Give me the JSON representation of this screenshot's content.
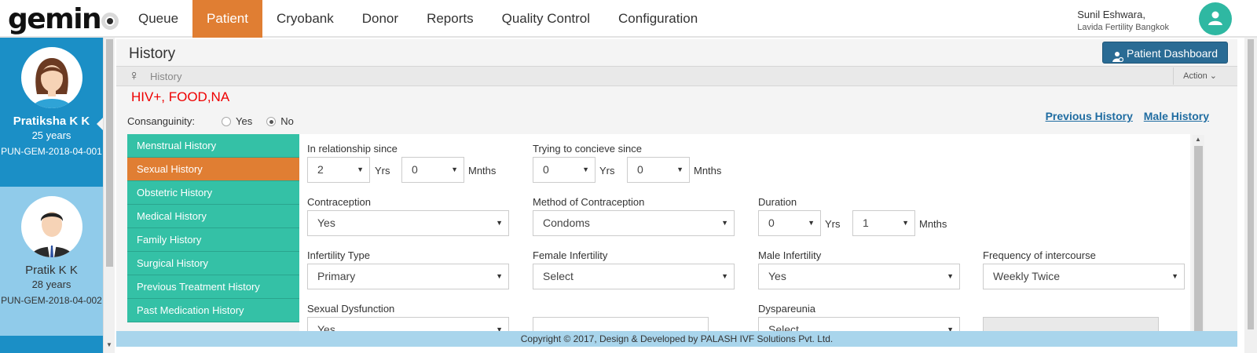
{
  "app": {
    "logo": "gemin"
  },
  "nav": {
    "items": [
      "Queue",
      "Patient",
      "Cryobank",
      "Donor",
      "Reports",
      "Quality Control",
      "Configuration"
    ],
    "active": "Patient"
  },
  "user": {
    "name": "Sunil Eshwara,",
    "org": "Lavida Fertility Bangkok"
  },
  "patients": [
    {
      "name": "Pratiksha K K",
      "age": "25 years",
      "id": "PUN-GEM-2018-04-001"
    },
    {
      "name": "Pratik K K",
      "age": "28 years",
      "id": "PUN-GEM-2018-04-002"
    }
  ],
  "page": {
    "title": "History",
    "dashboard_button": "Patient Dashboard",
    "breadcrumb": "History",
    "action": "Action",
    "alerts": "HIV+, FOOD,NA",
    "consanguinity": {
      "label": "Consanguinity:",
      "options": [
        "Yes",
        "No"
      ],
      "selected": "No"
    },
    "links": {
      "previous": "Previous History",
      "male": "Male History"
    }
  },
  "menu": {
    "items": [
      "Menstrual History",
      "Sexual History",
      "Obstetric History",
      "Medical History",
      "Family History",
      "Surgical History",
      "Previous Treatment History",
      "Past Medication History"
    ],
    "active": "Sexual History"
  },
  "form": {
    "relationship": {
      "label": "In relationship since",
      "years": "2",
      "months": "0",
      "yrs_unit": "Yrs",
      "mnths_unit": "Mnths"
    },
    "conceive": {
      "label": "Trying to concieve since",
      "years": "0",
      "months": "0",
      "yrs_unit": "Yrs",
      "mnths_unit": "Mnths"
    },
    "contraception": {
      "label": "Contraception",
      "value": "Yes"
    },
    "method": {
      "label": "Method of Contraception",
      "value": "Condoms"
    },
    "duration": {
      "label": "Duration",
      "years": "0",
      "months": "1",
      "yrs_unit": "Yrs",
      "mnths_unit": "Mnths"
    },
    "infertility_type": {
      "label": "Infertility Type",
      "value": "Primary"
    },
    "female_infertility": {
      "label": "Female Infertility",
      "value": "Select"
    },
    "male_infertility": {
      "label": "Male Infertility",
      "value": "Yes"
    },
    "frequency": {
      "label": "Frequency of intercourse",
      "value": "Weekly Twice"
    },
    "dysfunction": {
      "label": "Sexual Dysfunction",
      "value": "Yes"
    },
    "dyspareunia": {
      "label": "Dyspareunia",
      "value": "Select"
    }
  },
  "footer": "Copyright © 2017, Design & Developed by PALASH IVF Solutions Pvt. Ltd."
}
